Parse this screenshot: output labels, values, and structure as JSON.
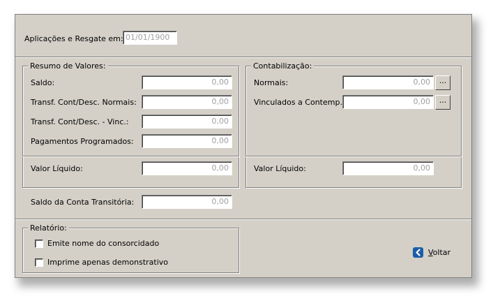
{
  "header": {
    "date_label": "Aplicações e Resgate em:",
    "date_value": "01/01/1900"
  },
  "resumo": {
    "title": "Resumo de Valores:",
    "rows": [
      {
        "label": "Saldo:",
        "value": "0,00"
      },
      {
        "label": "Transf. Cont/Desc. Normais:",
        "value": "0,00"
      },
      {
        "label": "Transf. Cont/Desc. - Vinc.:",
        "value": "0,00"
      },
      {
        "label": "Pagamentos Programados:",
        "value": "0,00"
      }
    ],
    "liquido_label": "Valor Líquido:",
    "liquido_value": "0,00"
  },
  "contab": {
    "title": "Contabilização:",
    "rows": [
      {
        "label": "Normais:",
        "value": "0,00",
        "button": "..."
      },
      {
        "label": "Vinculados a Contemp.:",
        "value": "0,00",
        "button": "..."
      }
    ],
    "liquido_label": "Valor Líquido:",
    "liquido_value": "0,00"
  },
  "transitoria": {
    "label": "Saldo da Conta Transitória:",
    "value": "0,00"
  },
  "relatorio": {
    "title": "Relatório:",
    "options": [
      {
        "label": "Emite nome do consorcidado",
        "checked": false
      },
      {
        "label": "Imprime apenas demonstrativo",
        "checked": false
      }
    ]
  },
  "voltar": {
    "label_rest": "oltar",
    "label_mnemonic": "V",
    "icon": "back-arrow-icon",
    "icon_color": "#1b5ea8"
  }
}
